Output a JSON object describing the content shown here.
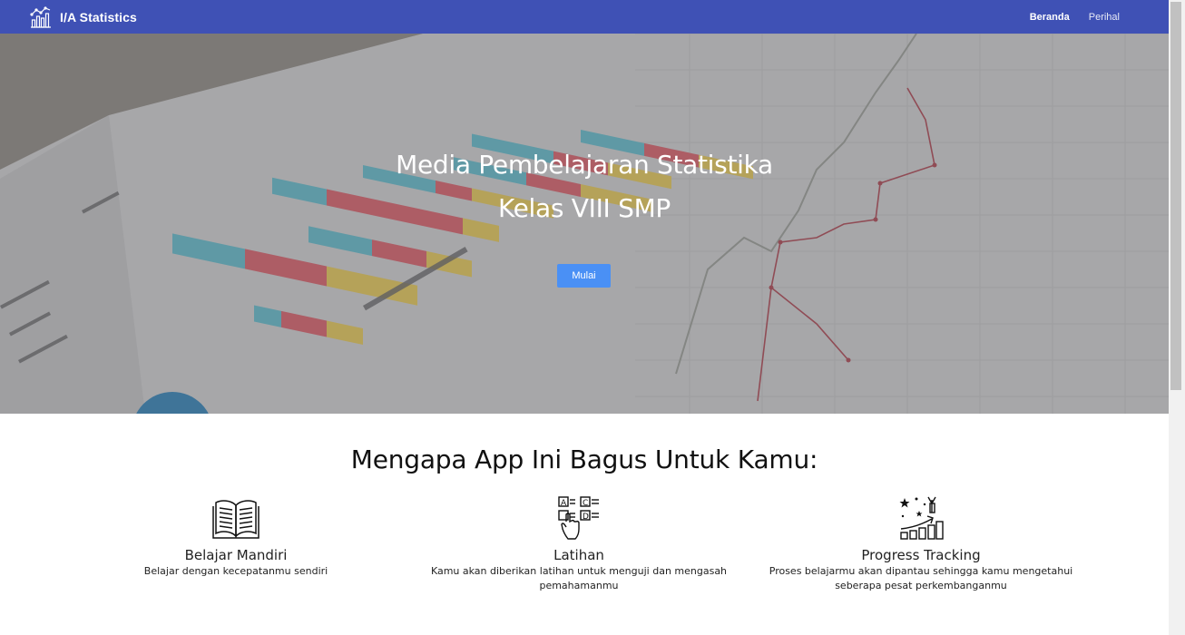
{
  "navbar": {
    "brand": "I/A Statistics",
    "links": [
      {
        "label": "Beranda",
        "active": true
      },
      {
        "label": "Perihal",
        "active": false
      }
    ],
    "color": "#3f51b5"
  },
  "hero": {
    "title_line1": "Media Pembelajaran Statistika",
    "title_line2": "Kelas VIII SMP",
    "button_label": "Mulai",
    "button_color": "#4a90f5"
  },
  "features": {
    "title": "Mengapa App Ini Bagus Untuk Kamu:",
    "items": [
      {
        "icon": "open-book-icon",
        "name": "Belajar Mandiri",
        "desc": "Belajar dengan kecepatanmu sendiri"
      },
      {
        "icon": "quiz-choice-icon",
        "name": "Latihan",
        "desc": "Kamu akan diberikan latihan untuk menguji dan mengasah pemahamanmu"
      },
      {
        "icon": "progress-stairs-icon",
        "name": "Progress Tracking",
        "desc": "Proses belajarmu akan dipantau sehingga kamu mengetahui seberapa pesat perkembanganmu"
      }
    ]
  }
}
